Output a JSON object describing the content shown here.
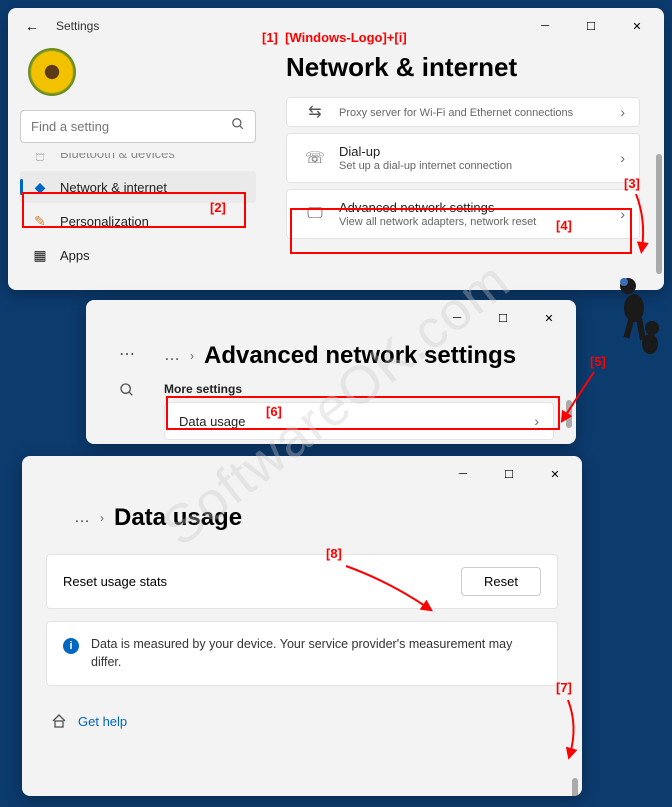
{
  "annotations": {
    "a1": "[1]",
    "a1_text": "[Windows-Logo]+[i]",
    "a2": "[2]",
    "a3": "[3]",
    "a4": "[4]",
    "a5": "[5]",
    "a6": "[6]",
    "a7": "[7]",
    "a8": "[8]"
  },
  "watermark": "SoftwareOK.com",
  "window1": {
    "title": "Settings",
    "search_placeholder": "Find a setting",
    "page_title": "Network & internet",
    "nav": {
      "bluetooth": "Bluetooth & devices",
      "network": "Network & internet",
      "personalization": "Personalization",
      "apps": "Apps"
    },
    "cards": {
      "proxy": {
        "title": "",
        "sub": "Proxy server for Wi-Fi and Ethernet connections"
      },
      "dialup": {
        "title": "Dial-up",
        "sub": "Set up a dial-up internet connection"
      },
      "advanced": {
        "title": "Advanced network settings",
        "sub": "View all network adapters, network reset"
      }
    }
  },
  "window2": {
    "breadcrumb_title": "Advanced network settings",
    "more_label": "More settings",
    "data_usage": "Data usage"
  },
  "window3": {
    "breadcrumb_title": "Data usage",
    "reset_label": "Reset usage stats",
    "reset_button": "Reset",
    "info_text": "Data is measured by your device. Your service provider's measurement may differ.",
    "get_help": "Get help"
  }
}
